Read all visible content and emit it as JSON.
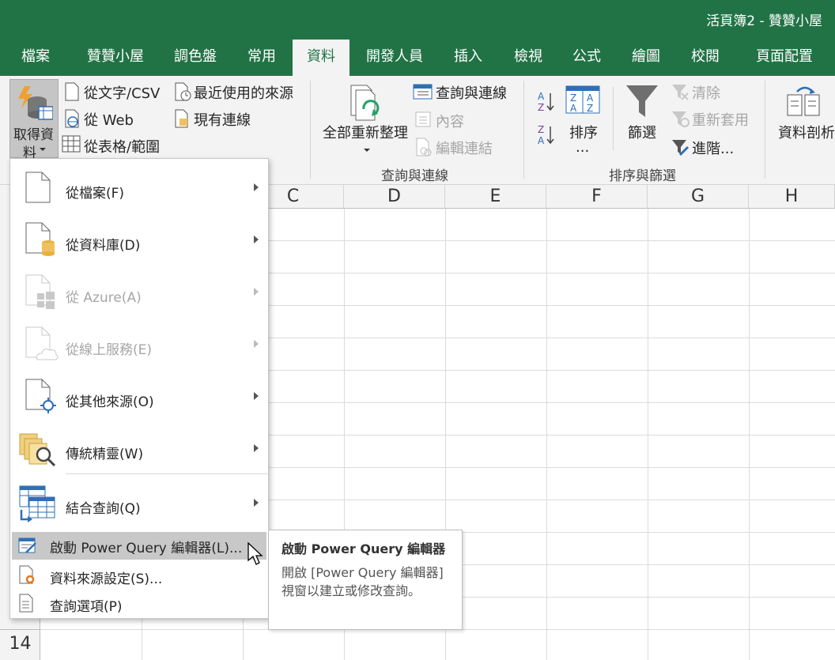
{
  "window": {
    "title": "活頁簿2  -  贊贊小屋"
  },
  "tabs": [
    {
      "label": "檔案",
      "active": false
    },
    {
      "label": "贊贊小屋",
      "active": false
    },
    {
      "label": "調色盤",
      "active": false
    },
    {
      "label": "常用",
      "active": false
    },
    {
      "label": "資料",
      "active": true
    },
    {
      "label": "開發人員",
      "active": false
    },
    {
      "label": "插入",
      "active": false
    },
    {
      "label": "檢視",
      "active": false
    },
    {
      "label": "公式",
      "active": false
    },
    {
      "label": "繪圖",
      "active": false
    },
    {
      "label": "校閱",
      "active": false
    },
    {
      "label": "頁面配置",
      "active": false
    }
  ],
  "ribbon": {
    "get_data": {
      "line1": "取得資",
      "line2": "料"
    },
    "from_text_csv": "從文字/CSV",
    "from_web": "從 Web",
    "from_table_range": "從表格/範圍",
    "recent_sources": "最近使用的來源",
    "existing_connections": "現有連線",
    "refresh_all": "全部重新整理",
    "queries_connections": "查詢與連線",
    "properties": "內容",
    "edit_links": "編輯連結",
    "group_queries": "查詢與連線",
    "sort": {
      "line1": "排序",
      "line2": "..."
    },
    "filter": "篩選",
    "clear": "清除",
    "reapply": "重新套用",
    "advanced": "進階...",
    "group_sort_filter": "排序與篩選",
    "data_analysis": "資料剖析"
  },
  "grid": {
    "columns": [
      "C",
      "D",
      "E",
      "F",
      "G",
      "H"
    ],
    "visible_row_number": "14"
  },
  "menu": {
    "items": [
      {
        "label": "從檔案(F)",
        "disabled": false,
        "submenu": true,
        "icon": "file-icon"
      },
      {
        "label": "從資料庫(D)",
        "disabled": false,
        "submenu": true,
        "icon": "database-icon"
      },
      {
        "label": "從 Azure(A)",
        "disabled": true,
        "submenu": true,
        "icon": "azure-icon"
      },
      {
        "label": "從線上服務(E)",
        "disabled": true,
        "submenu": true,
        "icon": "cloud-icon"
      },
      {
        "label": "從其他來源(O)",
        "disabled": false,
        "submenu": true,
        "icon": "other-sources-icon"
      },
      {
        "label": "傳統精靈(W)",
        "disabled": false,
        "submenu": true,
        "icon": "wizard-icon"
      },
      {
        "label": "結合查詢(Q)",
        "disabled": false,
        "submenu": true,
        "icon": "combine-queries-icon"
      }
    ],
    "launch_pq": "啟動 Power Query 編輯器(L)...",
    "data_source_settings": "資料來源設定(S)...",
    "query_options": "查詢選項(P)"
  },
  "tooltip": {
    "title": "啟動 Power Query 編輯器",
    "body": "開啟 [Power Query 編輯器] 視窗以建立或修改查詢。"
  },
  "colors": {
    "brand": "#217346",
    "ribbon_bg": "#f3f3f3",
    "highlight": "#c8c8c8"
  }
}
